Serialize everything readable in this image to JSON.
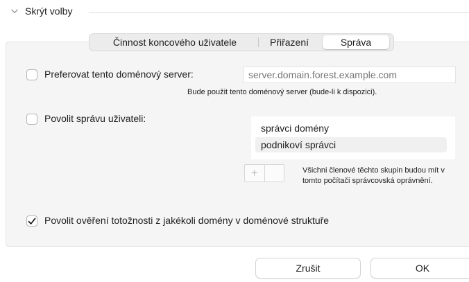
{
  "disclosure": {
    "label": "Skrýt volby",
    "icon": "chevron-down-icon"
  },
  "tabs": [
    {
      "label": "Činnost koncového uživatele",
      "selected": false
    },
    {
      "label": "Přiřazení",
      "selected": false
    },
    {
      "label": "Správa",
      "selected": true
    }
  ],
  "prefer_server": {
    "label": "Preferovat tento doménový server:",
    "checked": false,
    "placeholder": "server.domain.forest.example.com",
    "hint": "Bude použit tento doménový server (bude-li k dispozici)."
  },
  "allow_admin": {
    "label": "Povolit správu uživateli:",
    "checked": false,
    "groups": [
      {
        "label": "správci domény",
        "selected": false
      },
      {
        "label": "podnikoví správci",
        "selected": true
      }
    ],
    "add_symbol": "+",
    "note": "Všichni členové těchto skupin budou mít v tomto počítači správcovská oprávnění."
  },
  "allow_auth": {
    "label": "Povolit ověření totožnosti z jakékoli domény v doménové struktuře",
    "checked": true
  },
  "buttons": {
    "cancel": "Zrušit",
    "ok": "OK"
  },
  "colors": {
    "panel_bg": "#f5f5f5",
    "border": "#d3d3d3",
    "placeholder": "#b7b7b7"
  }
}
